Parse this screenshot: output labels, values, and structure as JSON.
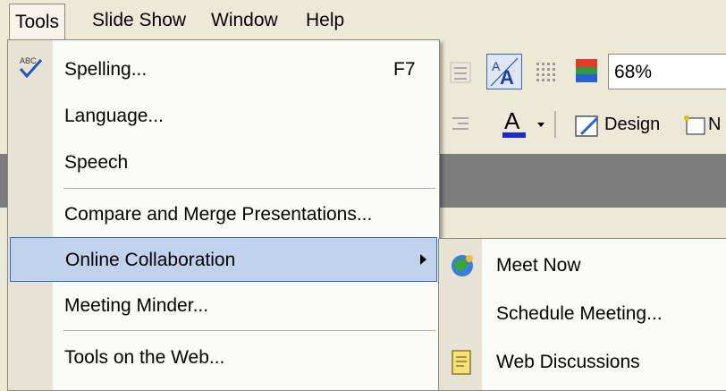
{
  "menubar": {
    "items": [
      {
        "label": "Tools",
        "open": true
      },
      {
        "label": "Slide Show"
      },
      {
        "label": "Window"
      },
      {
        "label": "Help"
      }
    ]
  },
  "toolbar": {
    "zoom": "68%",
    "design_label": "Design",
    "next_label_partial": "N"
  },
  "tools_menu": {
    "items": [
      {
        "label": "Spelling...",
        "shortcut": "F7",
        "icon": "spelling-check-icon"
      },
      {
        "label": "Language..."
      },
      {
        "label": "Speech"
      },
      {
        "label": "Compare and Merge Presentations..."
      },
      {
        "label": "Online Collaboration",
        "has_submenu": true,
        "highlighted": true
      },
      {
        "label": "Meeting Minder..."
      },
      {
        "label": "Tools on the Web..."
      }
    ]
  },
  "submenu": {
    "items": [
      {
        "label": "Meet Now",
        "icon": "globe-meeting-icon"
      },
      {
        "label": "Schedule Meeting..."
      },
      {
        "label": "Web Discussions",
        "icon": "discussion-note-icon"
      }
    ]
  },
  "colors": {
    "menu_bg": "#fbfbf7",
    "gutter": "#e6e3d4",
    "highlight_bg": "#c1d2ee",
    "highlight_border": "#316ac5",
    "chrome": "#ece9d8"
  }
}
